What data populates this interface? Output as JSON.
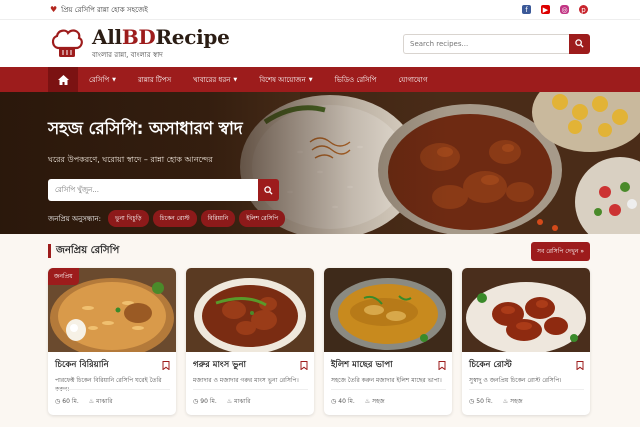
{
  "topbar": {
    "heart_icon": "heart-icon",
    "text": "প্রিয় রেসিপি রান্না হোক সহজেই",
    "social": [
      "facebook-icon",
      "youtube-icon",
      "instagram-icon",
      "pinterest-icon"
    ]
  },
  "header": {
    "brand_prefix": "All",
    "brand_main": "BD",
    "brand_suffix": "Recipe",
    "tagline": "বাংলার রান্না, বাংলার স্বাদ",
    "search_placeholder": "Search recipes..."
  },
  "nav": {
    "items": [
      {
        "label": "রেসিপি",
        "dropdown": true
      },
      {
        "label": "রান্নার টিপস",
        "dropdown": false
      },
      {
        "label": "খাবারের ধরন",
        "dropdown": true
      },
      {
        "label": "বিশেষ আয়োজন",
        "dropdown": true
      },
      {
        "label": "ভিডিও রেসিপি",
        "dropdown": false
      },
      {
        "label": "যোগাযোগ",
        "dropdown": false
      }
    ]
  },
  "hero": {
    "title": "সহজ রেসিপি: অসাধারণ স্বাদ",
    "subtitle": "ঘরের উপকরণে, ঘরোয়া স্বাদে – রান্না হোক আনন্দের",
    "search_placeholder": "রেসিপি খুঁজুন...",
    "popular_label": "জনপ্রিয় অনুসন্ধান:",
    "popular_chips": [
      "ভুনা খিচুড়ি",
      "চিকেন রোস্ট",
      "বিরিয়ানি",
      "ইলিশ রেসিপি"
    ]
  },
  "popular_section": {
    "title": "জনপ্রিয় রেসিপি",
    "see_all": "সব রেসিপি দেখুন »"
  },
  "recipes": [
    {
      "badge": "জনপ্রিয়",
      "title": "চিকেন বিরিয়ানি",
      "desc": "পারফেক্ট চিকেন বিরিয়ানি রেসিপি ঘরেই তৈরি করুন।",
      "time": "60 মি.",
      "level": "মাঝারি"
    },
    {
      "badge": "",
      "title": "গরুর মাংস ভুনা",
      "desc": "মজাদার ও মজাদার গরুর মাংস ভুনা রেসিপি।",
      "time": "90 মি.",
      "level": "মাঝারি"
    },
    {
      "badge": "",
      "title": "ইলিশ মাছের ভাপা",
      "desc": "সহজে তৈরি করুন মজাদার ইলিশ মাছের ভাপা।",
      "time": "40 মি.",
      "level": "সহজ"
    },
    {
      "badge": "",
      "title": "চিকেন রোস্ট",
      "desc": "সুস্বাদু ও জনপ্রিয় চিকেন রোস্ট রেসিপি।",
      "time": "50 মি.",
      "level": "সহজ"
    }
  ],
  "colors": {
    "brand": "#9d1c1c",
    "nav_dark": "#7b1212",
    "page_bg": "#fbf7f2"
  }
}
